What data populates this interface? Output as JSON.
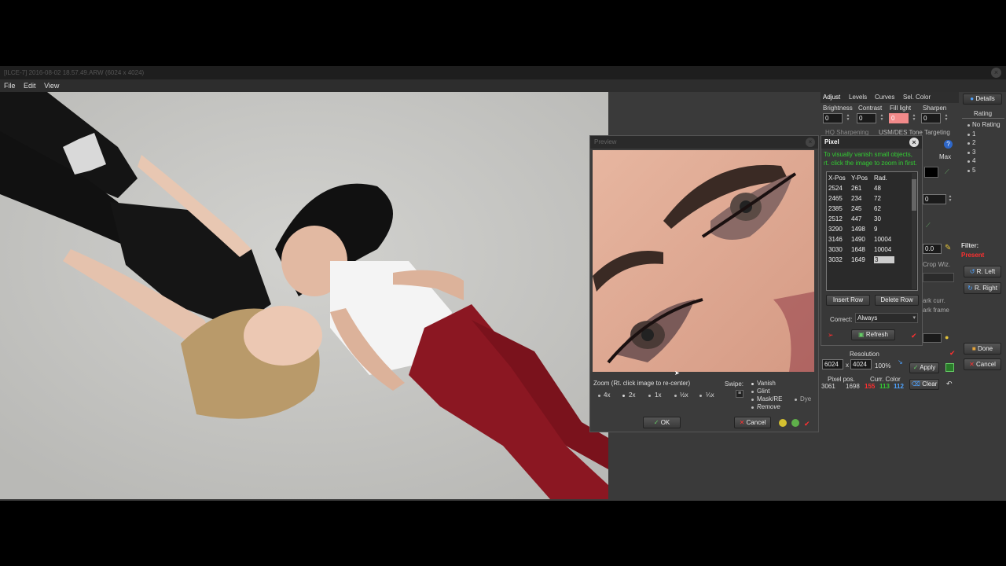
{
  "window": {
    "title": "[ILCE-7] 2016-08-02 18.57.49.ARW (6024 x 4024)"
  },
  "menu": [
    "File",
    "Edit",
    "View"
  ],
  "adjust_tabs": [
    "Adjust",
    "Levels",
    "Curves",
    "Sel. Color"
  ],
  "adjust_labels": [
    "Brightness",
    "Contrast",
    "Fill light",
    "Sharpen"
  ],
  "adjust_values": [
    "0",
    "0",
    "0",
    "0"
  ],
  "behind_panel": {
    "hq_sharpening": "HQ Sharpening",
    "tone_targeting": "USM/DES Tone Targeting",
    "max": "Max",
    "val_0": "0",
    "val_00": "0.0",
    "crop_wiz": "Crop Wiz.",
    "mark_curr": "ark curr.",
    "mark_frame": "ark frame"
  },
  "rating": {
    "details": "Details",
    "title": "Rating",
    "items": [
      "No Rating",
      "1",
      "2",
      "3",
      "4",
      "5"
    ],
    "filter_label": "Filter:",
    "filter_value": "Present",
    "rotate_left": "R. Left",
    "rotate_right": "R. Right",
    "done": "Done",
    "cancel": "Cancel"
  },
  "preview": {
    "title": "Preview",
    "zoom_label": "Zoom (Rt. click image to re-center)",
    "zoom_options": [
      "4x",
      "2x",
      "1x",
      "½x",
      "¼x"
    ],
    "swipe_label": "Swipe:",
    "swipe_options": [
      "Vanish",
      "Glint",
      "Mask/RE",
      "Remove"
    ],
    "dye": "Dye",
    "ok": "OK",
    "cancel": "Cancel"
  },
  "pixel": {
    "title": "Pixel",
    "hint1": "To visually vanish small objects,",
    "hint2": "rt. click the image to zoom in first.",
    "columns": [
      "X-Pos",
      "Y-Pos",
      "Rad."
    ],
    "rows": [
      [
        "2524",
        "261",
        "48"
      ],
      [
        "2465",
        "234",
        "72"
      ],
      [
        "2385",
        "245",
        "62"
      ],
      [
        "2512",
        "447",
        "30"
      ],
      [
        "3290",
        "1498",
        "9"
      ],
      [
        "3146",
        "1490",
        "10004"
      ],
      [
        "3030",
        "1648",
        "10004"
      ],
      [
        "3032",
        "1649",
        "3"
      ]
    ],
    "insert_row": "Insert Row",
    "delete_row": "Delete Row",
    "correct_label": "Correct:",
    "correct_value": "Always",
    "refresh": "Refresh"
  },
  "bottom": {
    "resolution_label": "Resolution",
    "res_w": "6024",
    "res_x": "x",
    "res_h": "4024",
    "res_pct": "100%",
    "apply": "Apply",
    "clear": "Clear",
    "pixel_pos_label": "Pixel pos.",
    "curr_color_label": "Curr. Color",
    "pos_x": "3061",
    "pos_y": "1698",
    "r": "155",
    "g": "113",
    "b": "112"
  },
  "colors": {
    "accent_red": "#ff3030",
    "green_text": "#33cc33",
    "fill_light_bg": "#f28a8a"
  }
}
